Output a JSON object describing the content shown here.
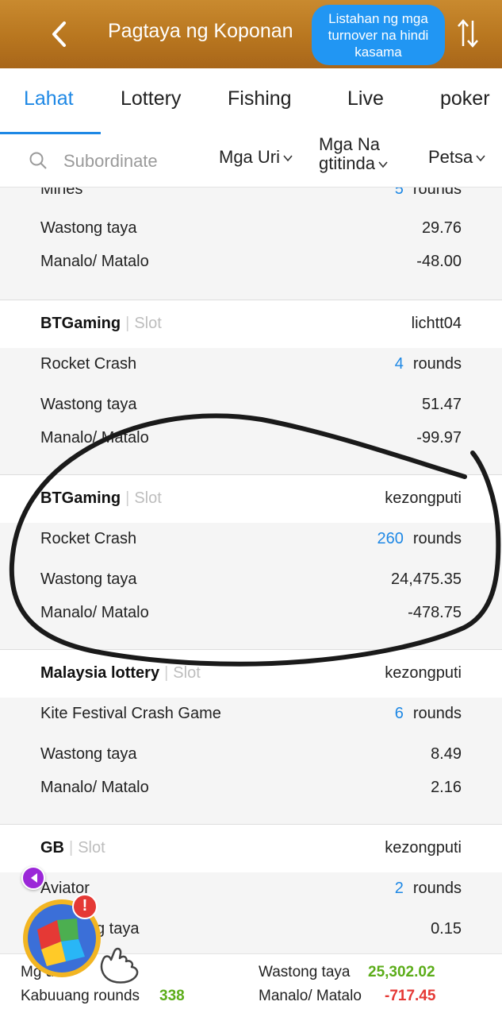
{
  "header": {
    "title": "Pagtaya ng Koponan",
    "turnover_button": "Listahan ng mga turnover na hindi kasama"
  },
  "tabs": [
    {
      "label": "Lahat",
      "active": true
    },
    {
      "label": "Lottery",
      "active": false
    },
    {
      "label": "Fishing",
      "active": false
    },
    {
      "label": "Live",
      "active": false
    },
    {
      "label": "poker",
      "active": false
    }
  ],
  "filters": {
    "search_placeholder": "Subordinate",
    "types": "Mga Uri",
    "merchants_line1": "Mga Na",
    "merchants_line2": "gtitinda",
    "date": "Petsa"
  },
  "partial_card": {
    "game": "Mines",
    "rounds": "5",
    "rounds_unit": "rounds",
    "valid_bet_label": "Wastong taya",
    "valid_bet": "29.76",
    "win_loss_label": "Manalo/ Matalo",
    "win_loss": "-48.00"
  },
  "cards": [
    {
      "provider": "BTGaming",
      "category": "Slot",
      "user": "lichtt04",
      "game": "Rocket Crash",
      "rounds": "4",
      "rounds_unit": "rounds",
      "valid_bet_label": "Wastong taya",
      "valid_bet": "51.47",
      "win_loss_label": "Manalo/ Matalo",
      "win_loss": "-99.97"
    },
    {
      "provider": "BTGaming",
      "category": "Slot",
      "user": "kezongputi",
      "game": "Rocket Crash",
      "rounds": "260",
      "rounds_unit": "rounds",
      "valid_bet_label": "Wastong taya",
      "valid_bet": "24,475.35",
      "win_loss_label": "Manalo/ Matalo",
      "win_loss": "-478.75"
    },
    {
      "provider": "Malaysia lottery",
      "category": "Slot",
      "user": "kezongputi",
      "game": "Kite Festival Crash Game",
      "rounds": "6",
      "rounds_unit": "rounds",
      "valid_bet_label": "Wastong taya",
      "valid_bet": "8.49",
      "win_loss_label": "Manalo/ Matalo",
      "win_loss": "2.16"
    },
    {
      "provider": "GB",
      "category": "Slot",
      "user": "kezongputi",
      "game": "Aviator",
      "rounds": "2",
      "rounds_unit": "rounds",
      "valid_bet_label": "g taya",
      "valid_bet": "0.15"
    }
  ],
  "footer": {
    "members_label": "Mg      dan",
    "total_rounds_label": "Kabuuang rounds",
    "total_rounds": "338",
    "valid_bet_label": "Wastong taya",
    "valid_bet": "25,302.02",
    "win_loss_label": "Manalo/ Matalo",
    "win_loss": "-717.45"
  },
  "colors": {
    "header": "#b8761f",
    "accent_blue": "#1e88e5",
    "positive_green": "#5cad1a",
    "negative_red": "#e53935"
  },
  "icons": [
    "back-arrow-icon",
    "sort-swap-icon",
    "search-icon",
    "chevron-down-icon",
    "game-widget-icon",
    "alert-icon",
    "pointer-hand-icon"
  ]
}
